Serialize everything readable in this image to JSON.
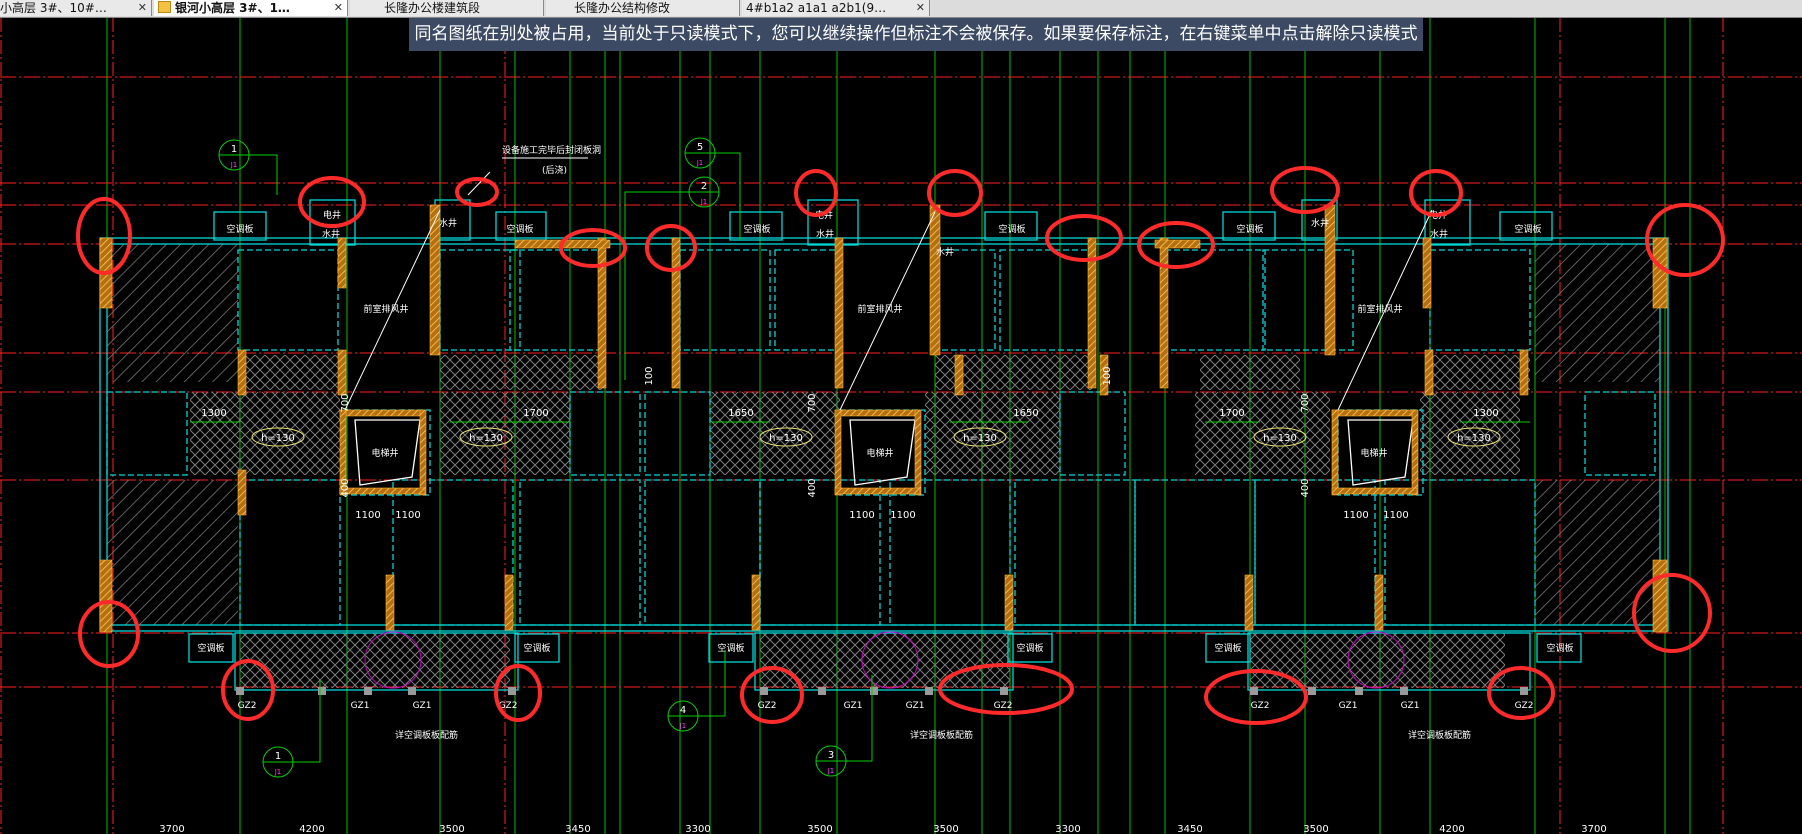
{
  "tabs": [
    {
      "label": "小高层 3#、10#…",
      "active": false
    },
    {
      "label": "银河小高层 3#、1…",
      "active": true
    },
    {
      "label": "长隆办公楼建筑段",
      "active": false
    },
    {
      "label": "长隆办公结构修改",
      "active": false
    },
    {
      "label": "4#b1a2 a1a1 a2b1(9…",
      "active": false
    }
  ],
  "banner": {
    "text": "同名图纸在别处被占用，当前处于只读模式下，您可以继续操作但标注不会被保存。如果要保存标注，在右键菜单中点击解除只读模式"
  },
  "plan": {
    "room_labels": {
      "aircon": "空调板",
      "elec_well": "电井",
      "water_well": "水井",
      "smoke_well": "前室排风井",
      "elevator": "电梯井",
      "note_top": "设备施工完毕后封闭板洞",
      "note_top2": "(后浇)"
    },
    "slab_labels": [
      "h=130",
      "h=130",
      "h=130",
      "h=130",
      "h=130",
      "h=130"
    ],
    "span_dims": [
      "1300",
      "1700",
      "1650",
      "1650",
      "1700",
      "1300"
    ],
    "small_dims": [
      "700",
      "400",
      "700",
      "400",
      "700",
      "400",
      "100",
      "100"
    ],
    "elev_dims": [
      "1100",
      "1100",
      "1100",
      "1100",
      "1100",
      "1100"
    ],
    "column_labels": [
      "GZ2",
      "GZ1",
      "GZ1",
      "GZ2",
      "GZ2",
      "GZ1",
      "GZ1",
      "GZ2",
      "GZ2",
      "GZ1",
      "GZ1",
      "GZ2"
    ],
    "callouts": [
      {
        "num": "1",
        "sheet": "J1"
      },
      {
        "num": "5",
        "sheet": "J1"
      },
      {
        "num": "2",
        "sheet": "J1"
      },
      {
        "num": "4",
        "sheet": "J1"
      },
      {
        "num": "1",
        "sheet": "J1"
      },
      {
        "num": "3",
        "sheet": "J1"
      }
    ],
    "note_bottom": "详空调板板配筋",
    "bottom_dims": [
      "3700",
      "4200",
      "3500",
      "3450",
      "3300",
      "3500",
      "3500",
      "3300",
      "3450",
      "3500",
      "4200",
      "3700"
    ]
  },
  "colors": {
    "background": "#000000",
    "wall": "#00e0e0",
    "axis_red": "#ff2020",
    "axis_green": "#00d000",
    "column_fill": "#f0a020",
    "markup_circle": "#ff2a2a",
    "banner_bg": "#3d4a63",
    "slab_hatch": "#8a8a8a",
    "text_white": "#ffffff",
    "text_yellow": "#ffff60"
  }
}
